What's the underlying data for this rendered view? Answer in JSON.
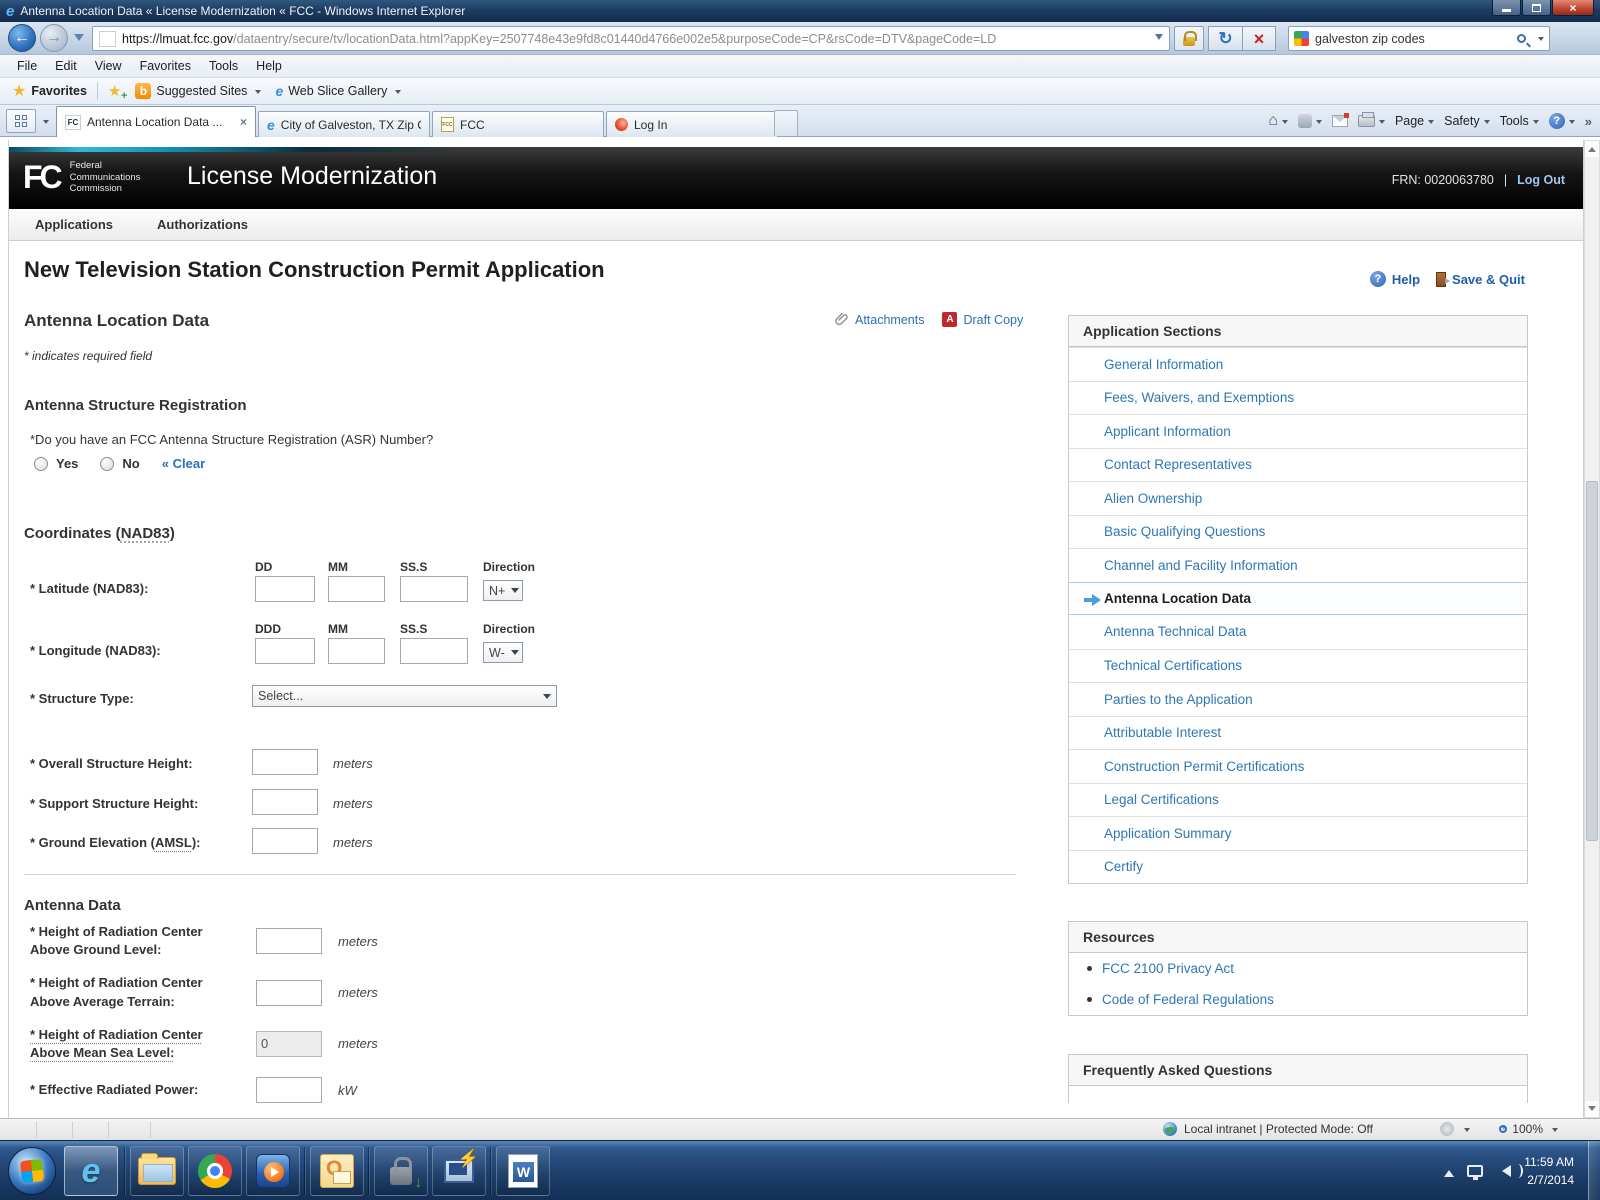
{
  "window": {
    "title": "Antenna Location Data « License Modernization « FCC - Windows Internet Explorer",
    "url_domain": "https://lmuat.fcc.gov",
    "url_path": "/dataentry/secure/tv/locationData.html?appKey=2507748e43e9fd8c01440d4766e002e5&purposeCode=CP&rsCode=DTV&pageCode=LD",
    "search_value": "galveston zip codes"
  },
  "menu": {
    "items": [
      {
        "label": "File"
      },
      {
        "label": "Edit"
      },
      {
        "label": "View"
      },
      {
        "label": "Favorites"
      },
      {
        "label": "Tools"
      },
      {
        "label": "Help"
      }
    ]
  },
  "favorites_bar": {
    "favorites_label": "Favorites",
    "suggested_label": "Suggested Sites",
    "webslice_label": "Web Slice Gallery"
  },
  "tabs": {
    "items": [
      {
        "label": "Antenna Location Data ...",
        "cls": "t-fcc",
        "active": true
      },
      {
        "label": "City of Galveston, TX Zip C...",
        "cls": "t-ie"
      },
      {
        "label": "FCC",
        "cls": "t-page"
      },
      {
        "label": "Log In",
        "cls": "t-login"
      }
    ]
  },
  "command_bar": {
    "page_label": "Page",
    "safety_label": "Safety",
    "tools_label": "Tools"
  },
  "site": {
    "logo_acronym": "FC",
    "logo_line1": "Federal",
    "logo_line2": "Communications",
    "logo_line3": "Commission",
    "app_title": "License Modernization",
    "frn": "FRN: 0020063780",
    "sep": "|",
    "logout_label": "Log Out",
    "nav": [
      {
        "label": "Applications"
      },
      {
        "label": "Authorizations"
      }
    ]
  },
  "page": {
    "title": "New Television Station Construction Permit Application",
    "help_label": "Help",
    "save_quit_label": "Save & Quit",
    "section_heading": "Antenna Location Data",
    "attachments_label": "Attachments",
    "draft_copy_label": "Draft Copy",
    "pdf_badge": "A",
    "required_note": "* indicates required field",
    "asr": {
      "heading": "Antenna Structure Registration",
      "question": "*Do you have an FCC Antenna Structure Registration (ASR) Number?",
      "yes_label": "Yes",
      "no_label": "No",
      "clear_label": "« Clear"
    },
    "coordinates": {
      "heading_prefix": "Coordinates (",
      "heading_term": "NAD83",
      "heading_suffix": ")",
      "lat": {
        "label": "* Latitude (NAD83):",
        "col1": "DD",
        "col2": "MM",
        "col3": "SS.S",
        "dir_label": "Direction",
        "dir_value": "N+"
      },
      "lon": {
        "label": "* Longitude (NAD83):",
        "col1": "DDD",
        "col2": "MM",
        "col3": "SS.S",
        "dir_label": "Direction",
        "dir_value": "W-"
      },
      "structure_type_label": "* Structure Type:",
      "structure_type_value": "Select...",
      "overall_label": "* Overall Structure Height:",
      "overall_unit": "meters",
      "support_label": "* Support Structure Height:",
      "support_unit": "meters",
      "ground_label_prefix": "* Ground Elevation (",
      "ground_term": "AMSL",
      "ground_label_suffix": "):",
      "ground_unit": "meters"
    },
    "antenna": {
      "heading": "Antenna Data",
      "fields": [
        {
          "label": "* Height of Radiation Center Above Ground Level:",
          "unit": "meters",
          "value": ""
        },
        {
          "label": "* Height of Radiation Center Above Average Terrain:",
          "unit": "meters",
          "value": ""
        },
        {
          "label": "* Height of Radiation Center Above Mean Sea Level:",
          "unit": "meters",
          "value": "0",
          "cls": "dotted-label disabled"
        },
        {
          "label": "* Effective Radiated Power:",
          "unit": "kW",
          "value": ""
        }
      ]
    }
  },
  "sidebar": {
    "sections_title": "Application Sections",
    "items": [
      {
        "label": "General Information"
      },
      {
        "label": "Fees, Waivers, and Exemptions"
      },
      {
        "label": "Applicant Information"
      },
      {
        "label": "Contact Representatives"
      },
      {
        "label": "Alien Ownership"
      },
      {
        "label": "Basic Qualifying Questions"
      },
      {
        "label": "Channel and Facility Information"
      },
      {
        "label": "Antenna Location Data",
        "active": true
      },
      {
        "label": "Antenna Technical Data"
      },
      {
        "label": "Technical Certifications"
      },
      {
        "label": "Parties to the Application"
      },
      {
        "label": "Attributable Interest"
      },
      {
        "label": "Construction Permit Certifications"
      },
      {
        "label": "Legal Certifications"
      },
      {
        "label": "Application Summary"
      },
      {
        "label": "Certify"
      }
    ],
    "resources_title": "Resources",
    "resources": [
      {
        "label": "FCC 2100 Privacy Act"
      },
      {
        "label": "Code of Federal Regulations"
      }
    ],
    "faq_title": "Frequently Asked Questions"
  },
  "status_bar": {
    "zone_text": "Local intranet | Protected Mode: Off",
    "zoom_value": "100%"
  },
  "taskbar": {
    "icons": [
      "start",
      "internet-explorer",
      "file-explorer",
      "chrome",
      "media-player",
      "outlook",
      "secure-transfer",
      "putty",
      "word"
    ],
    "tray_time": "11:59 AM",
    "tray_date": "2/7/2014"
  }
}
